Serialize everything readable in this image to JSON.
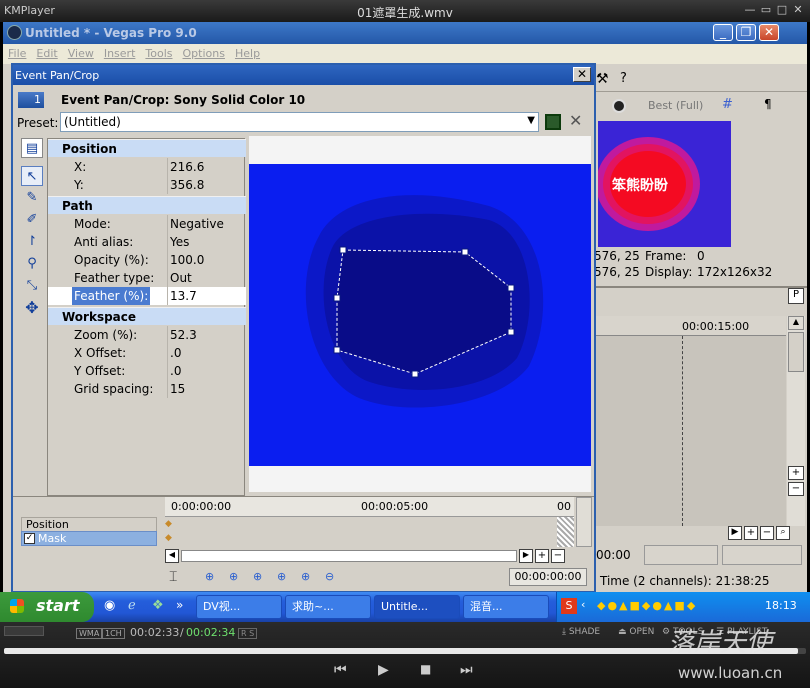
{
  "kmplayer": {
    "logo": "KMPlayer",
    "title": "01遮罩生成.wmv",
    "controls": {
      "minimize": "—",
      "restore": "▭",
      "maximize": "□",
      "close": "✕"
    }
  },
  "vegas": {
    "title": "Untitled * - Vegas Pro 9.0",
    "menu": [
      "File",
      "Edit",
      "View",
      "Insert",
      "Tools",
      "Options",
      "Help"
    ]
  },
  "dialog": {
    "title": "Event Pan/Crop",
    "event_number": "1",
    "event_title": "Event Pan/Crop: Sony Solid Color 10",
    "preset_label": "Preset:",
    "preset_value": "(Untitled)",
    "sections": [
      {
        "name": "Position",
        "rows": [
          {
            "key": "X:",
            "value": "216.6"
          },
          {
            "key": "Y:",
            "value": "356.8"
          }
        ]
      },
      {
        "name": "Path",
        "rows": [
          {
            "key": "Mode:",
            "value": "Negative"
          },
          {
            "key": "Anti alias:",
            "value": "Yes"
          },
          {
            "key": "Opacity (%):",
            "value": "100.0"
          },
          {
            "key": "Feather type:",
            "value": "Out"
          },
          {
            "key": "Feather (%):",
            "value": "13.7",
            "selected": true
          }
        ]
      },
      {
        "name": "Workspace",
        "rows": [
          {
            "key": "Zoom (%):",
            "value": "52.3"
          },
          {
            "key": "X Offset:",
            "value": ".0"
          },
          {
            "key": "Y Offset:",
            "value": ".0"
          },
          {
            "key": "Grid spacing:",
            "value": "15"
          }
        ]
      }
    ],
    "timeline": {
      "time_0": "0:00:00:00",
      "time_5": "00:00:05:00",
      "time_end": "00",
      "tracks": [
        "Position",
        "Mask"
      ],
      "current_time": "00:00:00:00"
    },
    "colors": {
      "canvas": "#0a1ef0",
      "mask_outer": "#0c18c8",
      "mask_mid": "#0b12a8",
      "mask_inner": "#090c88"
    }
  },
  "right_pane": {
    "preview_mode": "Best (Full)",
    "preview_text": "笨熊盼盼",
    "frame_label": "Frame:",
    "frame_value": "0",
    "display_label": "Display:",
    "display_value": "172x126x32",
    "coord_1": "576, 25",
    "coord_2": "576, 25",
    "ruler_time": "00:00:15:00",
    "cursor_time": "00:00",
    "record_time": "Time (2 channels): 21:38:25"
  },
  "taskbar": {
    "start": "start",
    "tasks": [
      "DV视...",
      "求助~...",
      "Untitle...",
      "混音..."
    ],
    "clock": "18:13"
  },
  "player": {
    "badge_1": "WMA",
    "badge_2": "1CH",
    "elapsed": "00:02:33",
    "total": "00:02:34",
    "rs": "R S",
    "shade": "SHADE",
    "open": "OPEN",
    "tools": "TOOLS",
    "playlist": "PLAYLIST",
    "progress_fraction": 0.99,
    "watermark_text": "落岸天使",
    "watermark_url": "www.luoan.cn"
  }
}
